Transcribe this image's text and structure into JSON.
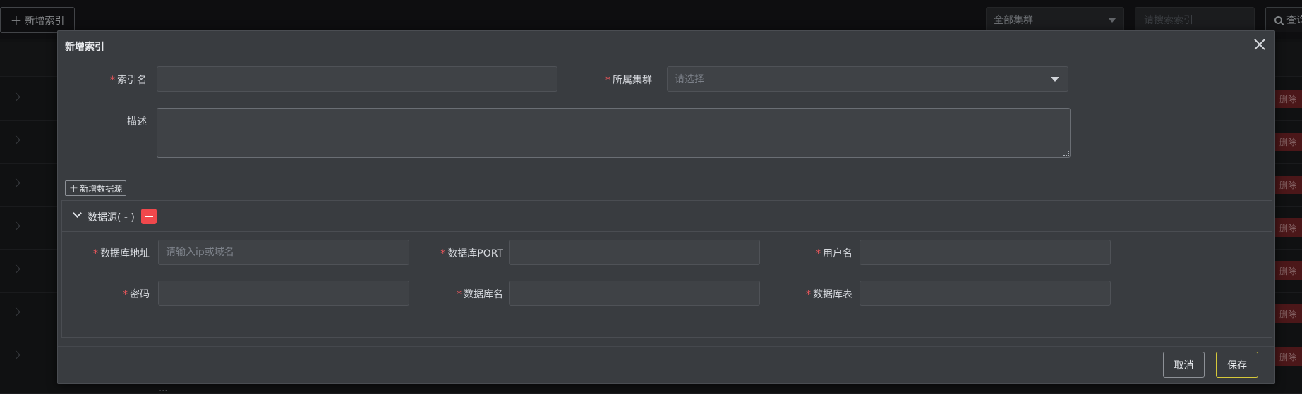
{
  "background": {
    "add_index_button": "新增索引",
    "cluster_select": "全部集群",
    "search_placeholder": "请搜索索引",
    "query_button": "查询",
    "delete_label": "删除",
    "footer_text": "..."
  },
  "modal": {
    "title": "新增索引",
    "form": {
      "index_name_label": "索引名",
      "cluster_label": "所属集群",
      "cluster_placeholder": "请选择",
      "description_label": "描述",
      "required_mark": "*"
    },
    "add_datasource_button": "新增数据源",
    "datasource": {
      "title": "数据源( - )",
      "db_address_label": "数据库地址",
      "db_address_placeholder": "请输入ip或域名",
      "db_port_label": "数据库PORT",
      "username_label": "用户名",
      "password_label": "密码",
      "db_name_label": "数据库名",
      "db_table_label": "数据库表"
    },
    "footer": {
      "cancel_label": "取消",
      "save_label": "保存"
    }
  },
  "colors": {
    "required": "#f0575c",
    "danger": "#f0484c",
    "save_border": "#d6c93a"
  }
}
